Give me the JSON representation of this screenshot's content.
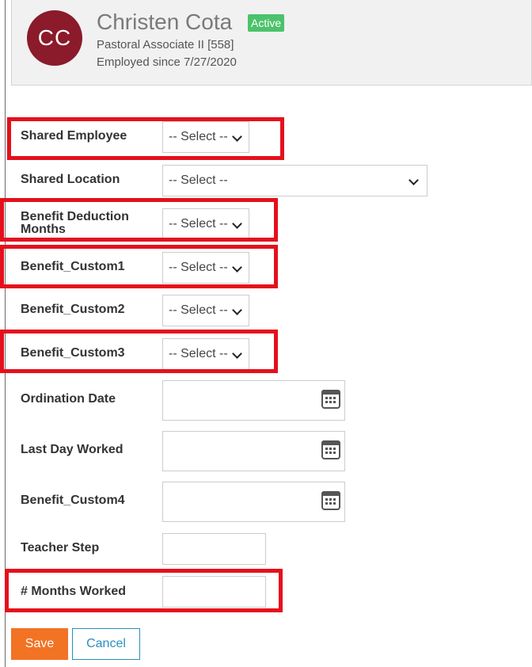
{
  "employee": {
    "initials": "CC",
    "name": "Christen Cota",
    "status": "Active",
    "title": "Pastoral Associate II [558]",
    "employed_since": "Employed since 7/27/2020"
  },
  "fields": {
    "shared_employee": {
      "label": "Shared Employee",
      "value": "-- Select --"
    },
    "shared_location": {
      "label": "Shared Location",
      "value": "-- Select --"
    },
    "benefit_deduction_months": {
      "label": "Benefit Deduction Months",
      "value": "-- Select --"
    },
    "benefit_custom1": {
      "label": "Benefit_Custom1",
      "value": "-- Select --"
    },
    "benefit_custom2": {
      "label": "Benefit_Custom2",
      "value": "-- Select --"
    },
    "benefit_custom3": {
      "label": "Benefit_Custom3",
      "value": "-- Select --"
    },
    "ordination_date": {
      "label": "Ordination Date",
      "value": ""
    },
    "last_day_worked": {
      "label": "Last Day Worked",
      "value": ""
    },
    "benefit_custom4": {
      "label": "Benefit_Custom4",
      "value": ""
    },
    "teacher_step": {
      "label": "Teacher Step",
      "value": ""
    },
    "months_worked": {
      "label": "# Months Worked",
      "value": ""
    }
  },
  "buttons": {
    "save": "Save",
    "cancel": "Cancel"
  },
  "icons": {
    "dropdown": "chevron-down-icon",
    "calendar": "calendar-icon"
  },
  "colors": {
    "avatar": "#8b1a2b",
    "active_badge": "#4cc26a",
    "highlight": "#e5101c",
    "save_button": "#f27324",
    "cancel_button": "#2a8fbf"
  }
}
